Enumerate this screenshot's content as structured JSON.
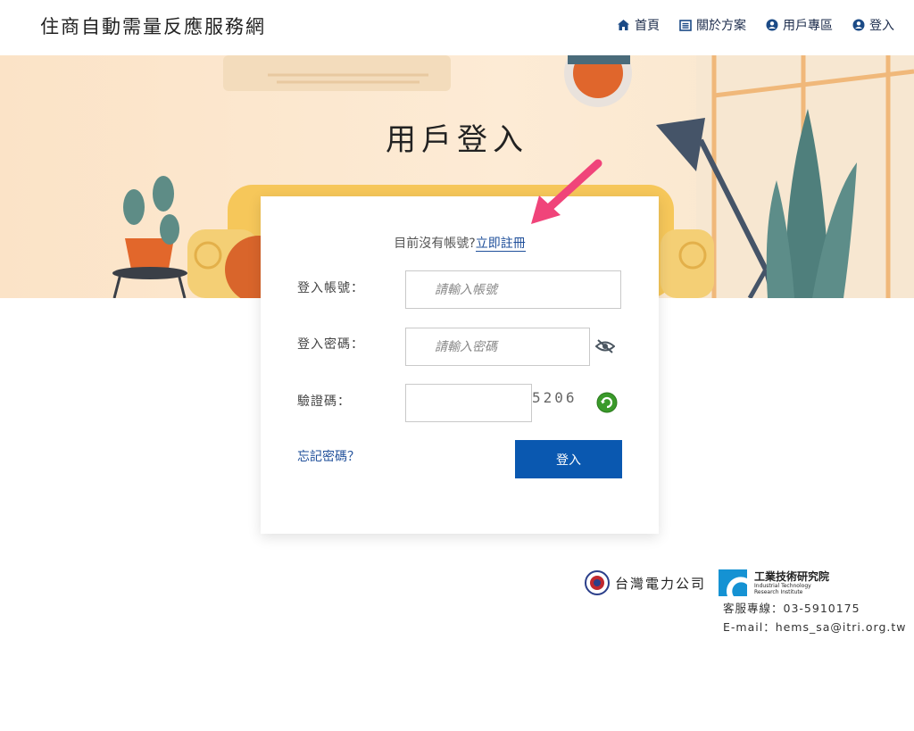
{
  "header": {
    "brand": "住商自動需量反應服務網",
    "nav": [
      {
        "label": "首頁",
        "icon": "home-icon"
      },
      {
        "label": "關於方案",
        "icon": "list-icon"
      },
      {
        "label": "用戶專區",
        "icon": "user-circle-icon"
      },
      {
        "label": "登入",
        "icon": "user-circle-icon"
      }
    ]
  },
  "hero": {
    "title": "用戶登入"
  },
  "login": {
    "register_prompt": "目前沒有帳號?",
    "register_link": "立即註冊",
    "account_label": "登入帳號：",
    "account_placeholder": "請輸入帳號",
    "password_label": "登入密碼：",
    "password_placeholder": "請輸入密碼",
    "captcha_label": "驗證碼：",
    "captcha_value": "5206",
    "forgot_label": "忘記密碼？",
    "submit_label": "登入"
  },
  "footer": {
    "taipower": "台灣電力公司",
    "itri_name": "工業技術研究院",
    "itri_en_1": "Industrial Technology",
    "itri_en_2": "Research Institute",
    "phone": "客服專線：03-5910175",
    "email": "E-mail：hems_sa@itri.org.tw"
  },
  "colors": {
    "primary": "#0a58b0",
    "link": "#1f4f9a",
    "hero_bg": "#fbe3c7",
    "arrow": "#f0447a"
  }
}
